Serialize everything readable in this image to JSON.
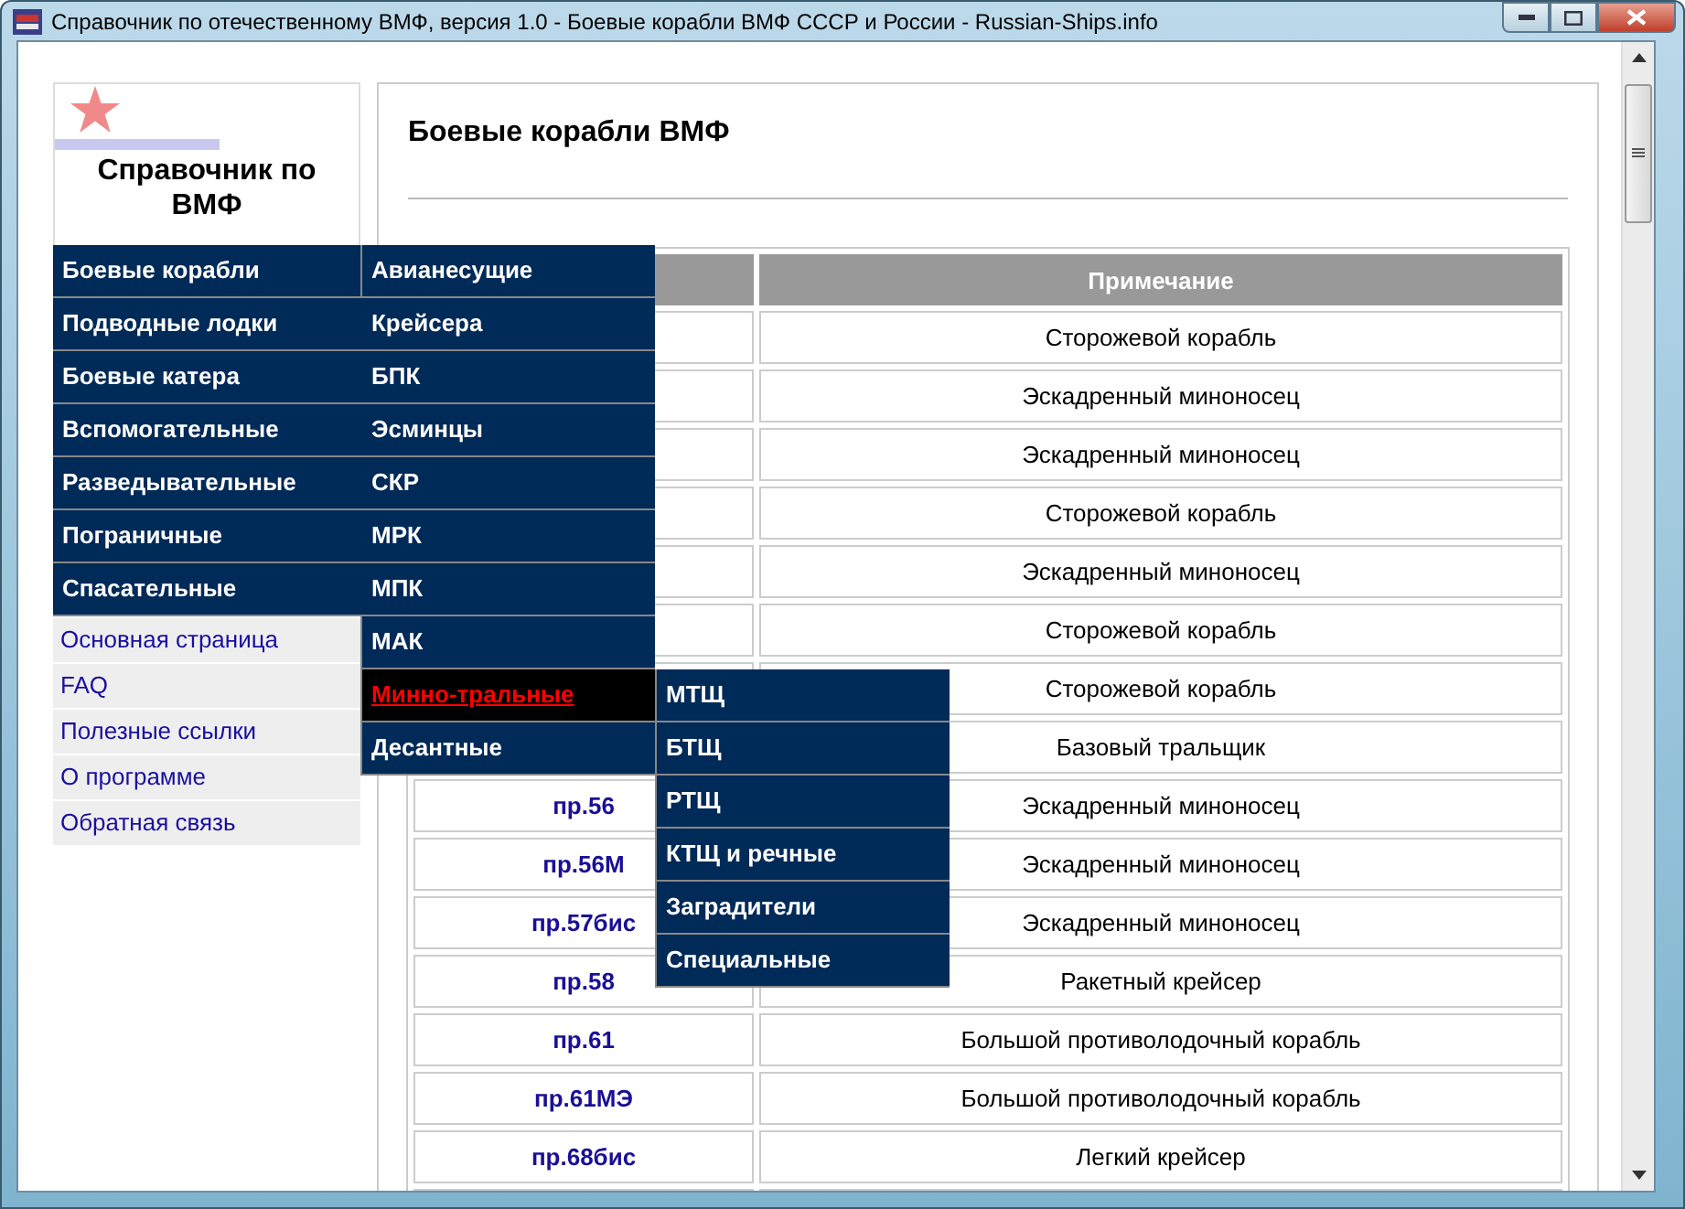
{
  "window": {
    "title": "Справочник по отечественному ВМФ, версия 1.0 - Боевые корабли ВМФ СССР и России - Russian-Ships.info"
  },
  "sidebar": {
    "logo_title": "Справочник по ВМФ",
    "menu": [
      {
        "label": "Боевые корабли",
        "children": [
          {
            "label": "Авианесущие",
            "selected": false
          },
          {
            "label": "Крейсера",
            "selected": false
          },
          {
            "label": "БПК",
            "selected": false
          },
          {
            "label": "Эсминцы",
            "selected": false
          },
          {
            "label": "СКР",
            "selected": false
          },
          {
            "label": "МРК",
            "selected": false
          },
          {
            "label": "МПК",
            "selected": false
          },
          {
            "label": "МАК",
            "selected": false
          },
          {
            "label": "Минно-тральные",
            "selected": true,
            "children": [
              {
                "label": "МТЩ"
              },
              {
                "label": "БТЩ"
              },
              {
                "label": "РТЩ"
              },
              {
                "label": "КТЩ и речные"
              },
              {
                "label": "Заградители"
              },
              {
                "label": "Специальные"
              }
            ]
          },
          {
            "label": "Десантные",
            "selected": false
          }
        ]
      },
      {
        "label": "Подводные лодки"
      },
      {
        "label": "Боевые катера"
      },
      {
        "label": "Вспомогательные"
      },
      {
        "label": "Разведывательные"
      },
      {
        "label": "Пограничные"
      },
      {
        "label": "Спасательные"
      }
    ],
    "links": [
      "Основная страница",
      "FAQ",
      "Полезные ссылки",
      "О программе",
      "Обратная связь"
    ]
  },
  "main": {
    "title": "Боевые корабли ВМФ",
    "table": {
      "note_header": "Примечание",
      "rows": [
        {
          "note": "Сторожевой корабль"
        },
        {
          "note": "Эскадренный миноносец"
        },
        {
          "note": "Эскадренный миноносец"
        },
        {
          "note": "Сторожевой корабль"
        },
        {
          "note": "Эскадренный миноносец"
        },
        {
          "note": "Сторожевой корабль"
        },
        {
          "note": "Сторожевой корабль"
        },
        {
          "note": "Базовый тральщик"
        },
        {
          "column_1": "пр.56",
          "note": "Эскадренный миноносец"
        },
        {
          "column_1": "пр.56М",
          "note": "Эскадренный миноносец"
        },
        {
          "column_1": "пр.57бис",
          "note": "Эскадренный миноносец"
        },
        {
          "column_1": "пр.58",
          "note": "Ракетный крейсер"
        },
        {
          "column_1": "пр.61",
          "note": "Большой противолодочный корабль"
        },
        {
          "column_1": "пр.61МЭ",
          "note": "Большой противолодочный корабль"
        },
        {
          "column_1": "пр.68бис",
          "note": "Легкий крейсер"
        },
        {}
      ]
    }
  }
}
